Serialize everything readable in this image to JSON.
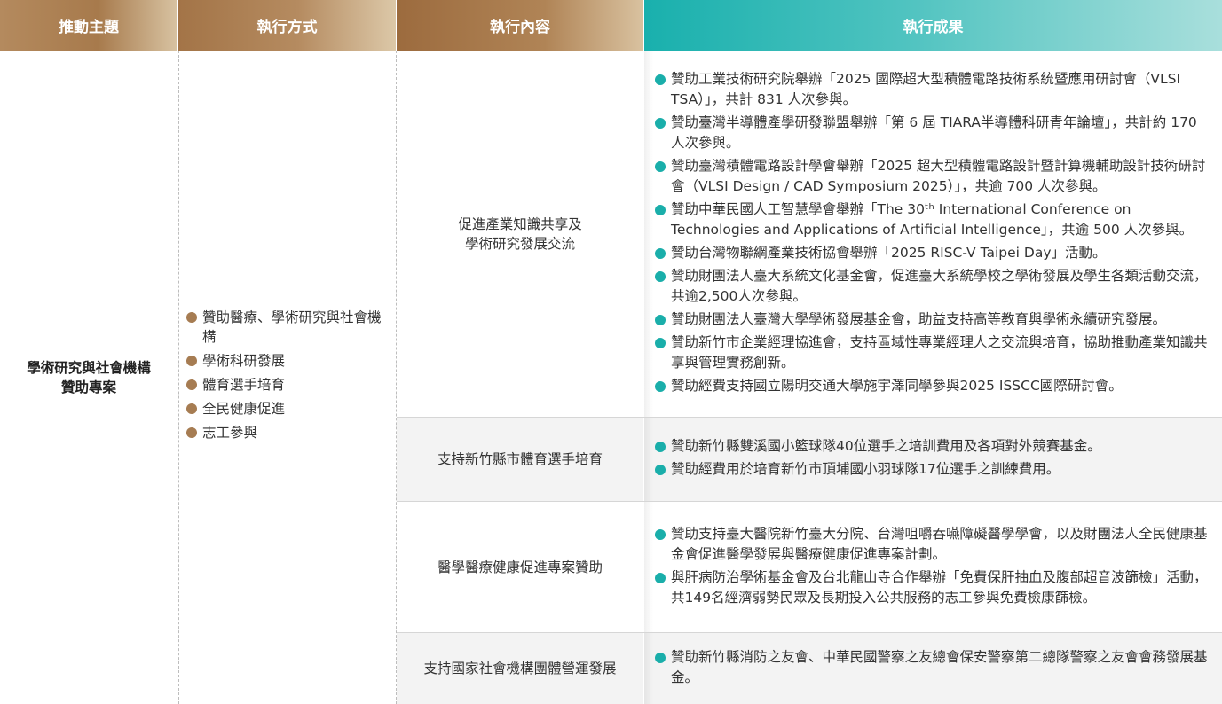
{
  "headers": {
    "theme": "推動主題",
    "method": "執行方式",
    "content": "執行內容",
    "result": "執行成果"
  },
  "theme": {
    "line1": "學術研究與社會機構",
    "line2": "贊助專案"
  },
  "methods": [
    "贊助醫療、學術研究與社會機構",
    "學術科研發展",
    "體育選手培育",
    "全民健康促進",
    "志工參與"
  ],
  "rows": [
    {
      "content_line1": "促進產業知識共享及",
      "content_line2": "學術研究發展交流",
      "results": [
        "贊助工業技術研究院舉辦「2025 國際超大型積體電路技術系統暨應用研討會（VLSI TSA）」，共計 831 人次參與。",
        "贊助臺灣半導體產學研發聯盟舉辦「第 6 屆 TIARA半導體科研青年論壇」，共計約 170 人次參與。",
        "贊助臺灣積體電路設計學會舉辦「2025 超大型積體電路設計暨計算機輔助設計技術研討會（VLSI Design / CAD Symposium 2025）」，共逾 700 人次參與。",
        "贊助中華民國人工智慧學會舉辦「The 30ᵗʰ International Conference on Technologies and Applications of Artificial Intelligence」，共逾 500 人次參與。",
        "贊助台灣物聯網產業技術協會舉辦「2025 RISC-V Taipei Day」活動。",
        "贊助財團法人臺大系統文化基金會，促進臺大系統學校之學術發展及學生各類活動交流，共逾2,500人次參與。",
        "贊助財團法人臺灣大學學術發展基金會，助益支持高等教育與學術永續研究發展。",
        "贊助新竹市企業經理協進會，支持區域性專業經理人之交流與培育，協助推動產業知識共享與管理實務創新。",
        "贊助經費支持國立陽明交通大學施宇澤同學參與2025 ISSCC國際研討會。"
      ]
    },
    {
      "content_line1": "支持新竹縣市體育選手培育",
      "content_line2": "",
      "results": [
        "贊助新竹縣雙溪國小籃球隊40位選手之培訓費用及各項對外競賽基金。",
        "贊助經費用於培育新竹市頂埔國小羽球隊17位選手之訓練費用。"
      ]
    },
    {
      "content_line1": "醫學醫療健康促進專案贊助",
      "content_line2": "",
      "results": [
        "贊助支持臺大醫院新竹臺大分院、台灣咀嚼吞嚥障礙醫學學會，以及財團法人全民健康基金會促進醫學發展與醫療健康促進專案計劃。",
        "與肝病防治學術基金會及台北龍山寺合作舉辦「免費保肝抽血及腹部超音波篩檢」活動，共149名經濟弱勢民眾及長期投入公共服務的志工參與免費檢康篩檢。"
      ]
    },
    {
      "content_line1": "支持國家社會機構團體營運發展",
      "content_line2": "",
      "results": [
        "贊助新竹縣消防之友會、中華民國警察之友總會保安警察第二總隊警察之友會會務發展基金。"
      ]
    }
  ],
  "colors": {
    "brown_accent": "#a67c52",
    "teal_accent": "#1aaeaa",
    "row_shade": "#f3f3f3"
  }
}
